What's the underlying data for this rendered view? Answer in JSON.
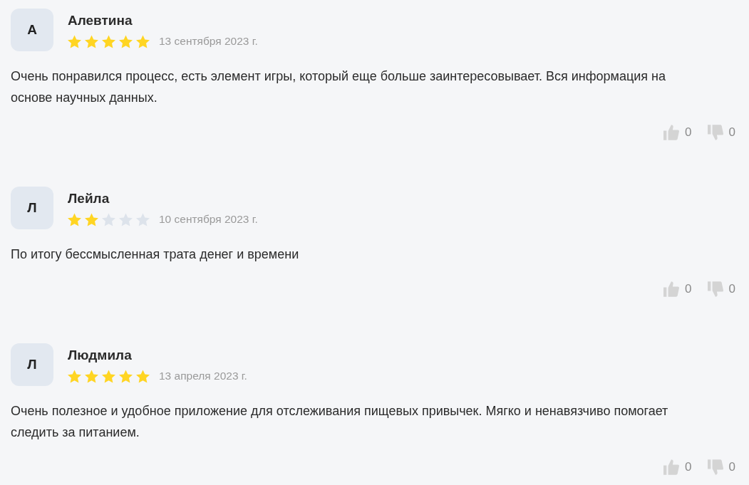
{
  "reviews": [
    {
      "initial": "А",
      "name": "Алевтина",
      "stars": 5,
      "date": "13 сентября 2023 г.",
      "text": "Очень понравился процесс, есть элемент игры, который еще больше заинтересовывает. Вся информация на основе научных данных.",
      "likes": "0",
      "dislikes": "0"
    },
    {
      "initial": "Л",
      "name": "Лейла",
      "stars": 2,
      "date": "10 сентября 2023 г.",
      "text": "По итогу бессмысленная трата денег и времени",
      "likes": "0",
      "dislikes": "0"
    },
    {
      "initial": "Л",
      "name": "Людмила",
      "stars": 5,
      "date": "13 апреля 2023 г.",
      "text": "Очень полезное и удобное приложение для отслеживания пищевых привычек. Мягко и ненавязчиво помогает следить за питанием.",
      "likes": "0",
      "dislikes": "0"
    }
  ]
}
